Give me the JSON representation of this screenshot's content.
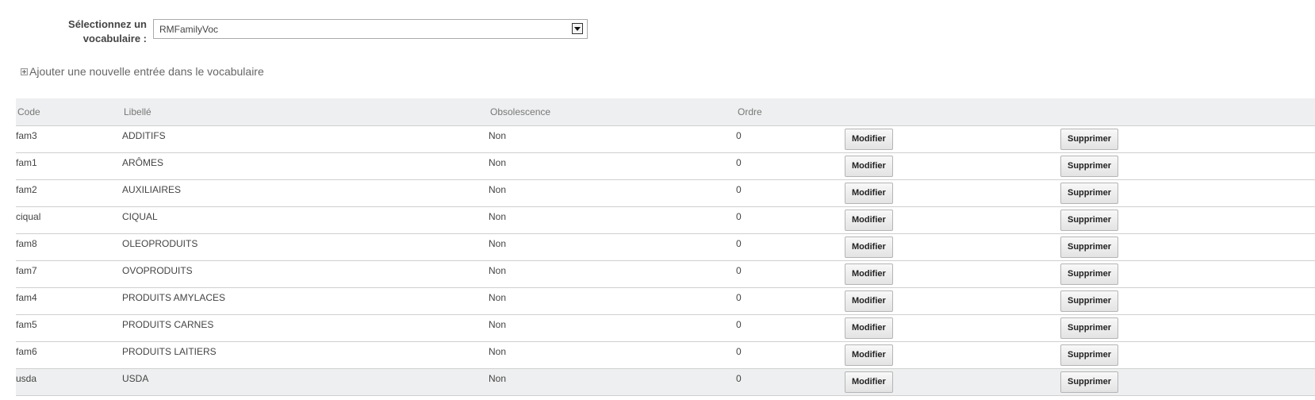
{
  "selector": {
    "label_line1": "Sélectionnez un",
    "label_line2": "vocabulaire :",
    "value": "RMFamilyVoc"
  },
  "add_entry": {
    "icon": "expand-icon",
    "label": "Ajouter une nouvelle entrée dans le vocabulaire"
  },
  "table": {
    "headers": [
      "Code",
      "Libellé",
      "Obsolescence",
      "Ordre"
    ],
    "modify_label": "Modifier",
    "delete_label": "Supprimer",
    "rows": [
      {
        "code": "fam3",
        "label": "ADDITIFS",
        "obsolete": "Non",
        "order": "0"
      },
      {
        "code": "fam1",
        "label": "ARÔMES",
        "obsolete": "Non",
        "order": "0"
      },
      {
        "code": "fam2",
        "label": "AUXILIAIRES",
        "obsolete": "Non",
        "order": "0"
      },
      {
        "code": "ciqual",
        "label": "CIQUAL",
        "obsolete": "Non",
        "order": "0"
      },
      {
        "code": "fam8",
        "label": "OLEOPRODUITS",
        "obsolete": "Non",
        "order": "0"
      },
      {
        "code": "fam7",
        "label": "OVOPRODUITS",
        "obsolete": "Non",
        "order": "0"
      },
      {
        "code": "fam4",
        "label": "PRODUITS AMYLACES",
        "obsolete": "Non",
        "order": "0"
      },
      {
        "code": "fam5",
        "label": "PRODUITS CARNES",
        "obsolete": "Non",
        "order": "0"
      },
      {
        "code": "fam6",
        "label": "PRODUITS LAITIERS",
        "obsolete": "Non",
        "order": "0"
      },
      {
        "code": "usda",
        "label": "USDA",
        "obsolete": "Non",
        "order": "0"
      }
    ]
  }
}
